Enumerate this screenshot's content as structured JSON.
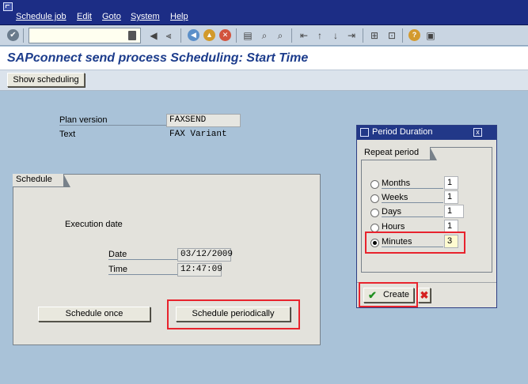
{
  "menu": {
    "items": [
      "Schedule job",
      "Edit",
      "Goto",
      "System",
      "Help"
    ]
  },
  "toolbar": {
    "command_value": ""
  },
  "header": {
    "title": "SAPconnect send process Scheduling: Start Time"
  },
  "apptoolbar": {
    "show_scheduling": "Show scheduling"
  },
  "plan": {
    "version_label": "Plan version",
    "version_value": "FAXSEND",
    "text_label": "Text",
    "text_value": "FAX Variant"
  },
  "schedule": {
    "group_title": "Schedule",
    "execution_label": "Execution date",
    "date_label": "Date",
    "date_value": "03/12/2009",
    "time_label": "Time",
    "time_value": "12:47:09",
    "once_button": "Schedule once",
    "periodically_button": "Schedule periodically"
  },
  "dialog": {
    "title": "Period Duration",
    "close_glyph": "x",
    "group_title": "Repeat period",
    "periods": [
      {
        "label": "Months",
        "value": "1",
        "selected": false
      },
      {
        "label": "Weeks",
        "value": "1",
        "selected": false
      },
      {
        "label": "Days",
        "value": "1",
        "selected": false
      },
      {
        "label": "Hours",
        "value": "1",
        "selected": false
      },
      {
        "label": "Minutes",
        "value": "3",
        "selected": true
      }
    ],
    "create_button": "Create"
  },
  "colors": {
    "menubar": "#1c2d85",
    "background": "#a9c2d8",
    "title_text": "#1c3c8c",
    "highlight": "#e8232d"
  }
}
